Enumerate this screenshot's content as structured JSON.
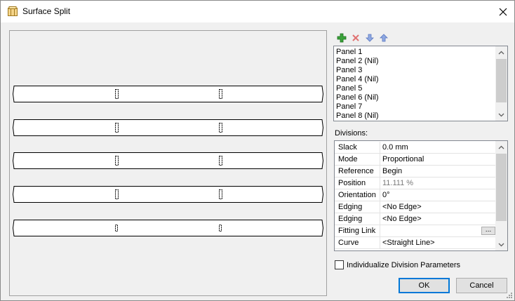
{
  "window": {
    "title": "Surface Split",
    "close_glyph": "✕"
  },
  "toolbar": {
    "buttons": [
      "add-icon",
      "delete-icon",
      "move-down-icon",
      "move-up-icon"
    ]
  },
  "panels": [
    "Panel 1",
    "Panel 2 (Nil)",
    "Panel 3",
    "Panel 4 (Nil)",
    "Panel 5",
    "Panel 6 (Nil)",
    "Panel 7",
    "Panel 8 (Nil)"
  ],
  "divisions": {
    "label": "Divisions:",
    "properties": [
      {
        "name": "Slack",
        "value": "0.0 mm"
      },
      {
        "name": "Mode",
        "value": "Proportional"
      },
      {
        "name": "Reference",
        "value": "Begin"
      },
      {
        "name": "Position",
        "value": "11.111 %"
      },
      {
        "name": "Orientation",
        "value": "0°"
      },
      {
        "name": "Edging",
        "value": "<No Edge>"
      },
      {
        "name": "Edging",
        "value": "<No Edge>"
      },
      {
        "name": "Fitting Link",
        "value": ""
      },
      {
        "name": "Curve",
        "value": "<Straight Line>"
      }
    ],
    "ellipsis_label": "..."
  },
  "options": {
    "individualize_label": "Individualize Division Parameters",
    "individualize_checked": false
  },
  "buttons": {
    "ok": "OK",
    "cancel": "Cancel"
  },
  "colors": {
    "accent": "#0078d7",
    "add": "#3aa33a",
    "delete": "#e05050",
    "arrow": "#6d8fd8"
  }
}
